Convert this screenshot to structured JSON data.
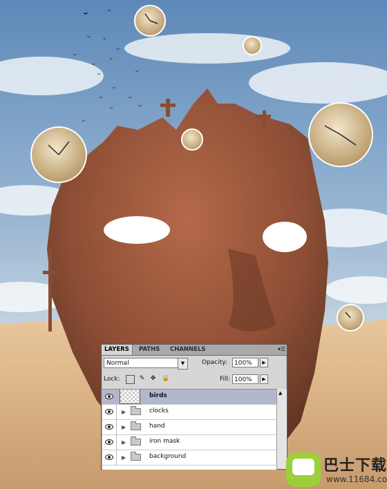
{
  "panel": {
    "tabs": [
      "LAYERS",
      "PATHS",
      "CHANNELS"
    ],
    "blend_mode": "Normal",
    "opacity_label": "Opacity:",
    "opacity_value": "100%",
    "lock_label": "Lock:",
    "fill_label": "Fill:",
    "fill_value": "100%",
    "layers": [
      {
        "name": "birds",
        "type": "layer",
        "selected": true
      },
      {
        "name": "clocks",
        "type": "group"
      },
      {
        "name": "hand",
        "type": "group"
      },
      {
        "name": "iron mask",
        "type": "group"
      },
      {
        "name": "background",
        "type": "group"
      }
    ]
  },
  "watermark": {
    "title": "巴士下载",
    "url": "www.11684.com"
  },
  "colors": {
    "sky": "#7fa3c6",
    "sand": "#d9b48a",
    "mask": "#9c5a3c",
    "selection": "#b3b7cd"
  }
}
